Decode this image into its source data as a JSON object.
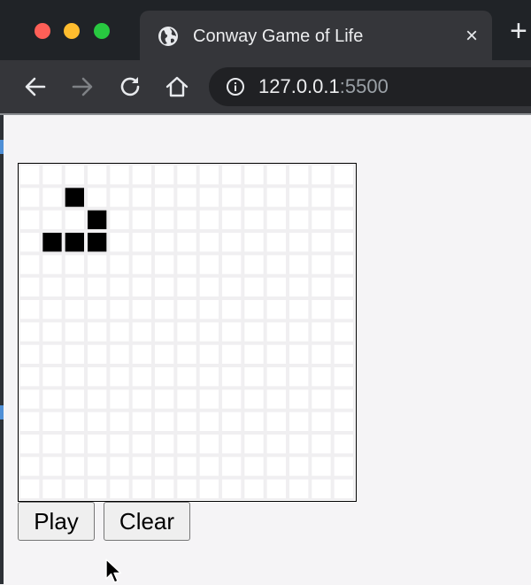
{
  "browser": {
    "tab_title": "Conway Game of Life",
    "url_host": "127.0.0.1",
    "url_port": ":5500",
    "new_tab_label": "+",
    "tab_close_label": "×",
    "icons": [
      "globe-icon",
      "close-icon",
      "plus-icon",
      "back-arrow-icon",
      "forward-arrow-icon",
      "reload-icon",
      "home-icon",
      "info-icon"
    ]
  },
  "game": {
    "grid_rows": 15,
    "grid_cols": 15,
    "live_cells": [
      [
        1,
        2
      ],
      [
        2,
        3
      ],
      [
        3,
        1
      ],
      [
        3,
        2
      ],
      [
        3,
        3
      ]
    ],
    "live_color": "#000000",
    "dead_color": "#ffffff",
    "grid_line_color": "#f0eff1"
  },
  "controls": {
    "play_label": "Play",
    "clear_label": "Clear"
  }
}
